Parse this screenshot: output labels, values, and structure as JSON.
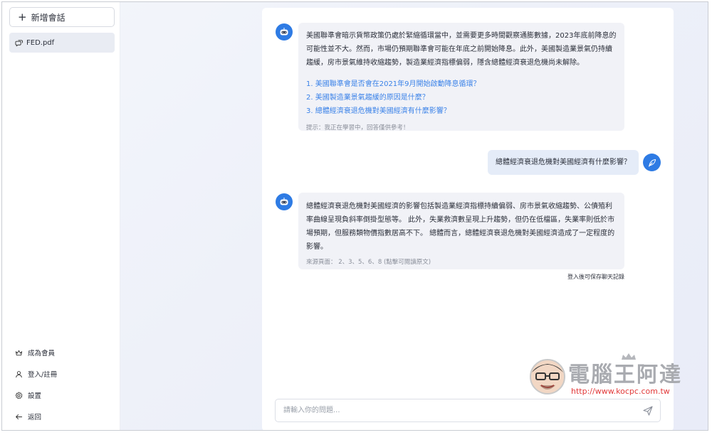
{
  "sidebar": {
    "new_chat_label": "新增會話",
    "file_name": "FED.pdf",
    "menu": [
      {
        "label": "成為會員",
        "icon": "crown-icon"
      },
      {
        "label": "登入/註冊",
        "icon": "user-icon"
      },
      {
        "label": "設置",
        "icon": "gear-icon"
      },
      {
        "label": "返回",
        "icon": "arrow-left-icon"
      }
    ]
  },
  "chat": {
    "message1": {
      "text": "美國聯準會暗示貨幣政策仍處於緊縮循環當中，並需要更多時間觀察通膨數據，2023年底前降息的可能性並不大。然而，市場仍預期聯準會可能在年底之前開始降息。此外，美國製造業景氣仍持續趨緩，房市景氣維持收縮趨勢，製造業經濟指標偏弱，隱含總體經濟衰退危機尚未解除。",
      "suggestions": [
        "1. 美國聯準會是否會在2021年9月開始啟動降息循環？",
        "2. 美國製造業景氣趨緩的原因是什麼？",
        "3. 總體經濟衰退危機對美國經濟有什麼影響？"
      ],
      "hint": "提示：我正在學習中，回答僅供參考！"
    },
    "user_message": "總體經濟衰退危機對美國經濟有什麼影響？",
    "message2": {
      "text": "總體經濟衰退危機對美國經濟的影響包括製造業經濟指標持續偏弱、房市景氣收縮趨勢、公債殖利率曲線呈現負斜率倒掛型態等。 此外，失業救濟數呈現上升趨勢，但仍在低檔區，失業率則低於市場預期，但服務類物價指數居高不下。 總體而言，總體經濟衰退危機對美國經濟造成了一定程度的影響。",
      "source": "來源頁面： 2、3、5、6、8 (點擊可閱讀原文)"
    },
    "save_note": "登入後可保存聊天記錄",
    "input_placeholder": "請輸入你的問題..."
  },
  "watermark": {
    "title": "電腦王阿達",
    "url": "http://www.kocpc.com.tw"
  },
  "colors": {
    "accent": "#2e7be4",
    "link": "#3a82e8",
    "bubble": "#f1f2f7",
    "user_bubble": "#e5ecf8"
  }
}
